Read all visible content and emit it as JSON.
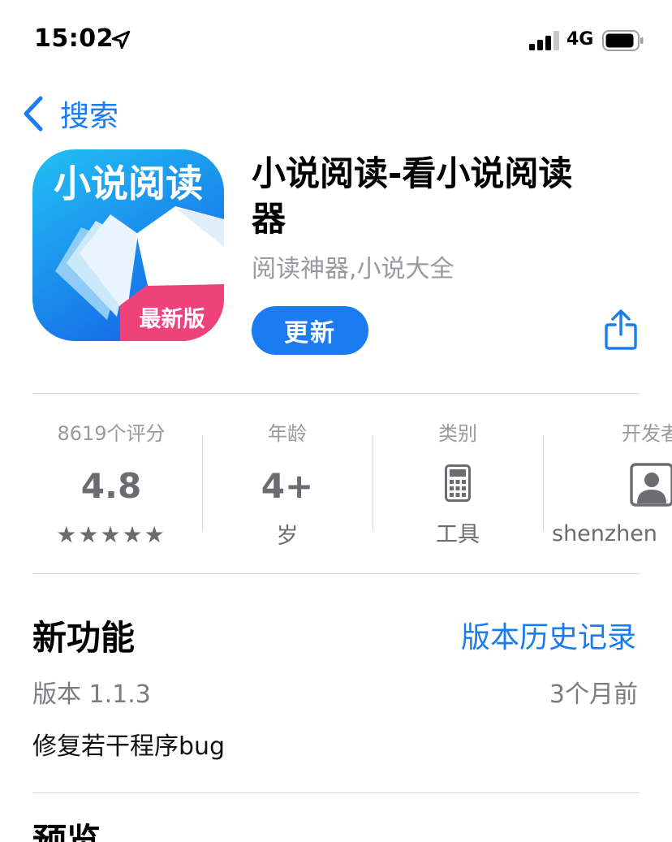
{
  "status_bar": {
    "time": "15:02",
    "network": "4G"
  },
  "nav": {
    "back_label": "搜索"
  },
  "app": {
    "icon_text": "小说阅读",
    "icon_badge": "最新版",
    "title": "小说阅读-看小说阅读器",
    "subtitle": "阅读神器,小说大全",
    "update_label": "更新"
  },
  "info": {
    "ratings_label": "8619个评分",
    "rating_value": "4.8",
    "stars": "★★★★★",
    "age_label": "年龄",
    "age_value": "4+",
    "age_unit": "岁",
    "category_label": "类别",
    "category_value": "工具",
    "developer_label": "开发者",
    "developer_value": "shenzhen"
  },
  "whats_new": {
    "title": "新功能",
    "history_link": "版本历史记录",
    "version": "版本 1.1.3",
    "time_ago": "3个月前",
    "notes": "修复若干程序bug"
  },
  "preview": {
    "title": "预览"
  },
  "colors": {
    "accent": "#1a7cf0",
    "secondary_text": "#9a9a9e",
    "divider": "#d7d7da"
  }
}
